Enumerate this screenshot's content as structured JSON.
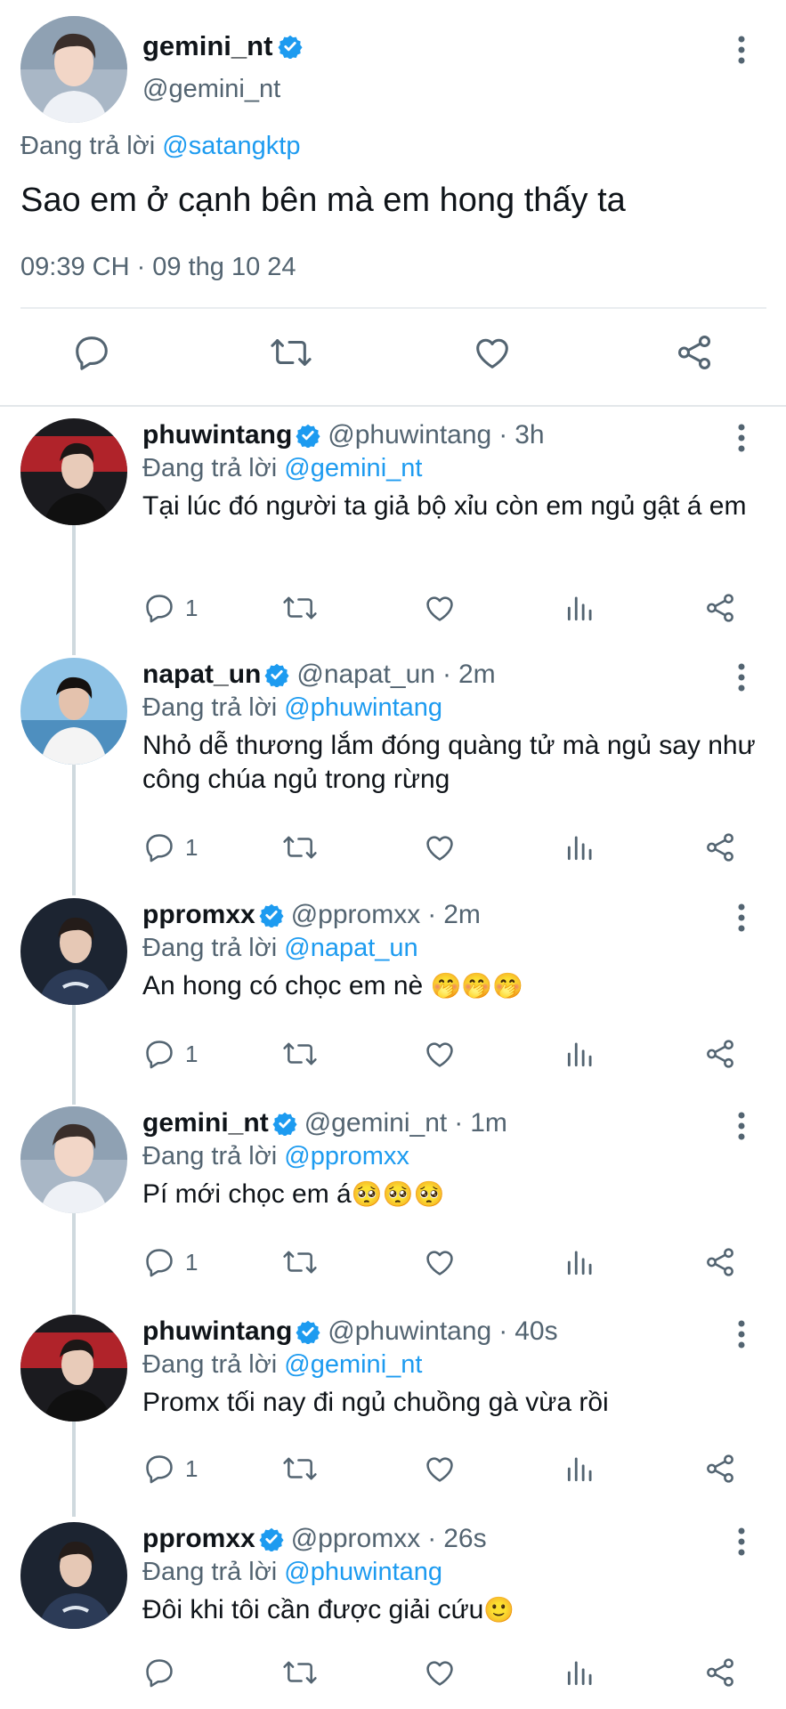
{
  "main_tweet": {
    "display_name": "gemini_nt",
    "handle": "@gemini_nt",
    "reply_prefix": "Đang trả lời",
    "reply_to": "@satangktp",
    "text": "Sao em ở cạnh bên mà em hong thấy ta",
    "timestamp": "09:39 CH · 09 thg 10 24",
    "actions": [
      "reply-icon",
      "retweet-icon",
      "like-icon",
      "share-icon"
    ]
  },
  "replies": [
    {
      "display_name": "phuwintang",
      "handle": "@phuwintang",
      "dot": "·",
      "time": "3h",
      "reply_prefix": "Đang trả lời",
      "reply_to": "@gemini_nt",
      "text": "Tại lúc đó người ta giả bộ xỉu còn em ngủ gật á em",
      "reply_count": "1"
    },
    {
      "display_name": "napat_un",
      "handle": "@napat_un",
      "dot": "·",
      "time": "2m",
      "reply_prefix": "Đang trả lời",
      "reply_to": "@phuwintang",
      "text": "Nhỏ dễ thương lắm đóng quàng tử mà ngủ say như công chúa ngủ trong rừng",
      "reply_count": "1"
    },
    {
      "display_name": "ppromxx",
      "handle": "@ppromxx",
      "dot": "·",
      "time": "2m",
      "reply_prefix": "Đang trả lời",
      "reply_to": "@napat_un",
      "text": "An hong có chọc em nè",
      "emoji": "🤭🤭🤭",
      "reply_count": "1"
    },
    {
      "display_name": "gemini_nt",
      "handle": "@gemini_nt",
      "dot": "·",
      "time": "1m",
      "reply_prefix": "Đang trả lời",
      "reply_to": "@ppromxx",
      "text": "Pí mới chọc em á",
      "emoji": "🥺🥺🥺",
      "reply_count": "1"
    },
    {
      "display_name": "phuwintang",
      "handle": "@phuwintang",
      "dot": "·",
      "time": "40s",
      "reply_prefix": "Đang trả lời",
      "reply_to": "@gemini_nt",
      "text": "Promx tối nay đi ngủ chuồng gà vừa rồi",
      "reply_count": "1"
    },
    {
      "display_name": "ppromxx",
      "handle": "@ppromxx",
      "dot": "·",
      "time": "26s",
      "reply_prefix": "Đang trả lời",
      "reply_to": "@phuwintang",
      "text": "Đôi khi tôi cần được giải cứu",
      "emoji": "🙂",
      "reply_count": ""
    }
  ],
  "colors": {
    "link": "#1d9bf0",
    "verified": "#1d9bf0",
    "secondary_text": "#536471",
    "icon": "#536471"
  }
}
